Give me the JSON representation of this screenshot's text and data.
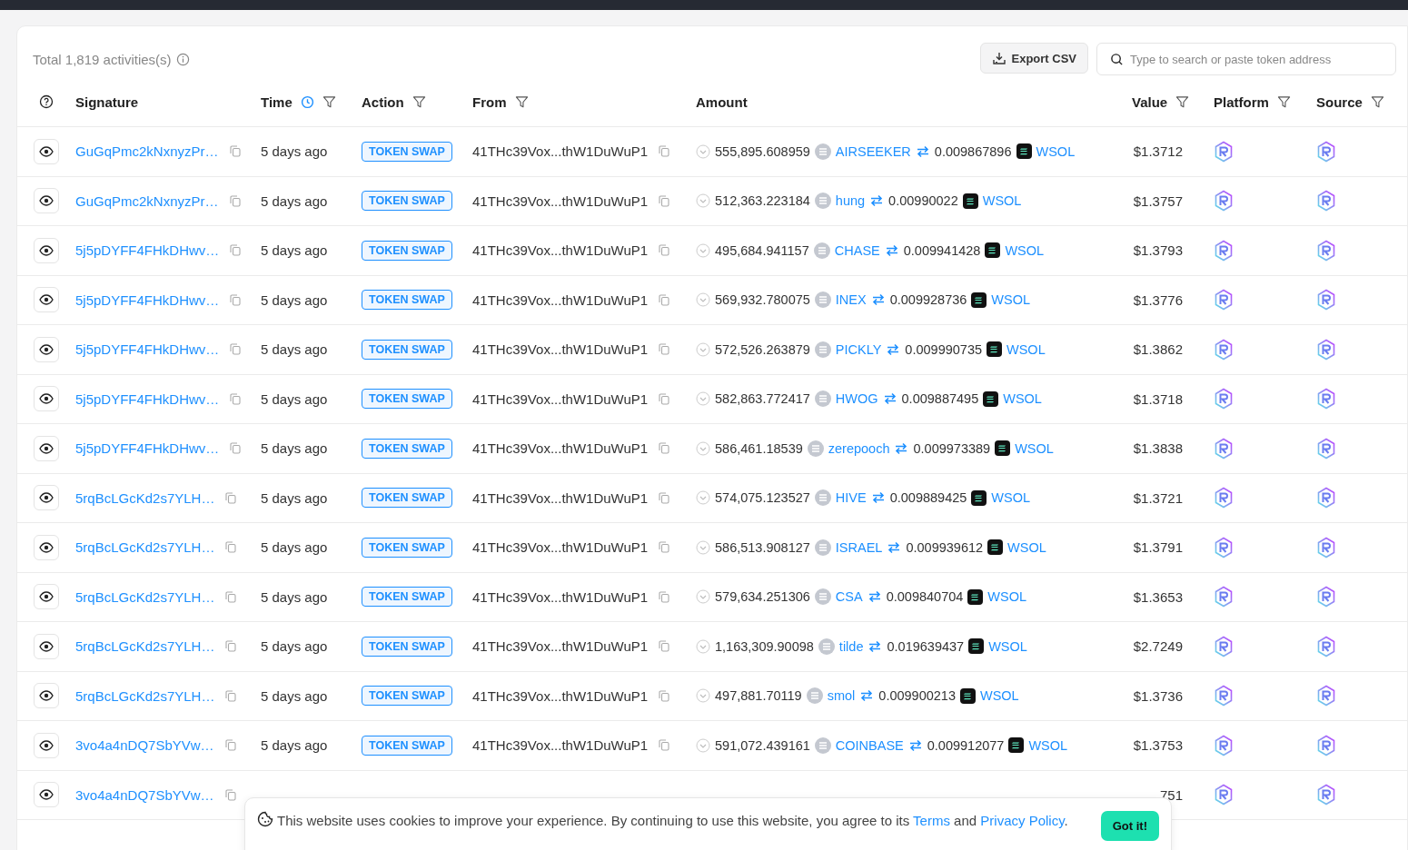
{
  "summary": {
    "total": "Total 1,819 activities(s)"
  },
  "toolbar": {
    "export_button": "Export CSV",
    "search": {
      "placeholder": "Type to search or paste token address"
    }
  },
  "table": {
    "columns": [
      {
        "label": "Signature",
        "clock": false,
        "filter": false
      },
      {
        "label": "Time",
        "clock": true,
        "filter": true
      },
      {
        "label": "Action",
        "clock": false,
        "filter": true
      },
      {
        "label": "From",
        "clock": false,
        "filter": true
      },
      {
        "label": "Amount",
        "clock": false,
        "filter": false
      },
      {
        "label": "Value",
        "clock": false,
        "filter": true
      },
      {
        "label": "Platform",
        "clock": false,
        "filter": true
      },
      {
        "label": "Source",
        "clock": false,
        "filter": true
      }
    ],
    "rows": [
      {
        "signature": "GuGqPmc2kNxnyzPr…",
        "time": "5 days ago",
        "action": "TOKEN SWAP",
        "from": "41THc39Vox...thW1DuWuP1",
        "amount_in": "555,895.608959",
        "token_in": "AIRSEEKER",
        "amount_out": "0.009867896",
        "token_out": "WSOL",
        "value": "$1.3712"
      },
      {
        "signature": "GuGqPmc2kNxnyzPr…",
        "time": "5 days ago",
        "action": "TOKEN SWAP",
        "from": "41THc39Vox...thW1DuWuP1",
        "amount_in": "512,363.223184",
        "token_in": "hung",
        "amount_out": "0.00990022",
        "token_out": "WSOL",
        "value": "$1.3757"
      },
      {
        "signature": "5j5pDYFF4FHkDHwv…",
        "time": "5 days ago",
        "action": "TOKEN SWAP",
        "from": "41THc39Vox...thW1DuWuP1",
        "amount_in": "495,684.941157",
        "token_in": "CHASE",
        "amount_out": "0.009941428",
        "token_out": "WSOL",
        "value": "$1.3793"
      },
      {
        "signature": "5j5pDYFF4FHkDHwv…",
        "time": "5 days ago",
        "action": "TOKEN SWAP",
        "from": "41THc39Vox...thW1DuWuP1",
        "amount_in": "569,932.780075",
        "token_in": "INEX",
        "amount_out": "0.009928736",
        "token_out": "WSOL",
        "value": "$1.3776"
      },
      {
        "signature": "5j5pDYFF4FHkDHwv…",
        "time": "5 days ago",
        "action": "TOKEN SWAP",
        "from": "41THc39Vox...thW1DuWuP1",
        "amount_in": "572,526.263879",
        "token_in": "PICKLY",
        "amount_out": "0.009990735",
        "token_out": "WSOL",
        "value": "$1.3862"
      },
      {
        "signature": "5j5pDYFF4FHkDHwv…",
        "time": "5 days ago",
        "action": "TOKEN SWAP",
        "from": "41THc39Vox...thW1DuWuP1",
        "amount_in": "582,863.772417",
        "token_in": "HWOG",
        "amount_out": "0.009887495",
        "token_out": "WSOL",
        "value": "$1.3718"
      },
      {
        "signature": "5j5pDYFF4FHkDHwv…",
        "time": "5 days ago",
        "action": "TOKEN SWAP",
        "from": "41THc39Vox...thW1DuWuP1",
        "amount_in": "586,461.18539",
        "token_in": "zerepooch",
        "amount_out": "0.009973389",
        "token_out": "WSOL",
        "value": "$1.3838"
      },
      {
        "signature": "5rqBcLGcKd2s7YLH…",
        "time": "5 days ago",
        "action": "TOKEN SWAP",
        "from": "41THc39Vox...thW1DuWuP1",
        "amount_in": "574,075.123527",
        "token_in": "HIVE",
        "amount_out": "0.009889425",
        "token_out": "WSOL",
        "value": "$1.3721"
      },
      {
        "signature": "5rqBcLGcKd2s7YLH…",
        "time": "5 days ago",
        "action": "TOKEN SWAP",
        "from": "41THc39Vox...thW1DuWuP1",
        "amount_in": "586,513.908127",
        "token_in": "ISRAEL",
        "amount_out": "0.009939612",
        "token_out": "WSOL",
        "value": "$1.3791"
      },
      {
        "signature": "5rqBcLGcKd2s7YLH…",
        "time": "5 days ago",
        "action": "TOKEN SWAP",
        "from": "41THc39Vox...thW1DuWuP1",
        "amount_in": "579,634.251306",
        "token_in": "CSA",
        "amount_out": "0.009840704",
        "token_out": "WSOL",
        "value": "$1.3653"
      },
      {
        "signature": "5rqBcLGcKd2s7YLH…",
        "time": "5 days ago",
        "action": "TOKEN SWAP",
        "from": "41THc39Vox...thW1DuWuP1",
        "amount_in": "1,163,309.90098",
        "token_in": "tilde",
        "amount_out": "0.019639437",
        "token_out": "WSOL",
        "value": "$2.7249"
      },
      {
        "signature": "5rqBcLGcKd2s7YLH…",
        "time": "5 days ago",
        "action": "TOKEN SWAP",
        "from": "41THc39Vox...thW1DuWuP1",
        "amount_in": "497,881.70119",
        "token_in": "smol",
        "amount_out": "0.009900213",
        "token_out": "WSOL",
        "value": "$1.3736"
      },
      {
        "signature": "3vo4a4nDQ7SbYVw…",
        "time": "5 days ago",
        "action": "TOKEN SWAP",
        "from": "41THc39Vox...thW1DuWuP1",
        "amount_in": "591,072.439161",
        "token_in": "COINBASE",
        "amount_out": "0.009912077",
        "token_out": "WSOL",
        "value": "$1.3753"
      },
      {
        "signature": "3vo4a4nDQ7SbYVw…",
        "value": "751"
      }
    ]
  },
  "cookie_banner": {
    "text_before": "This website uses cookies to improve your experience. By continuing to use this website, you agree to its ",
    "terms_link": "Terms",
    "text_middle": " and ",
    "privacy_link": "Privacy Policy",
    "text_after": ".",
    "button": "Got it!"
  }
}
